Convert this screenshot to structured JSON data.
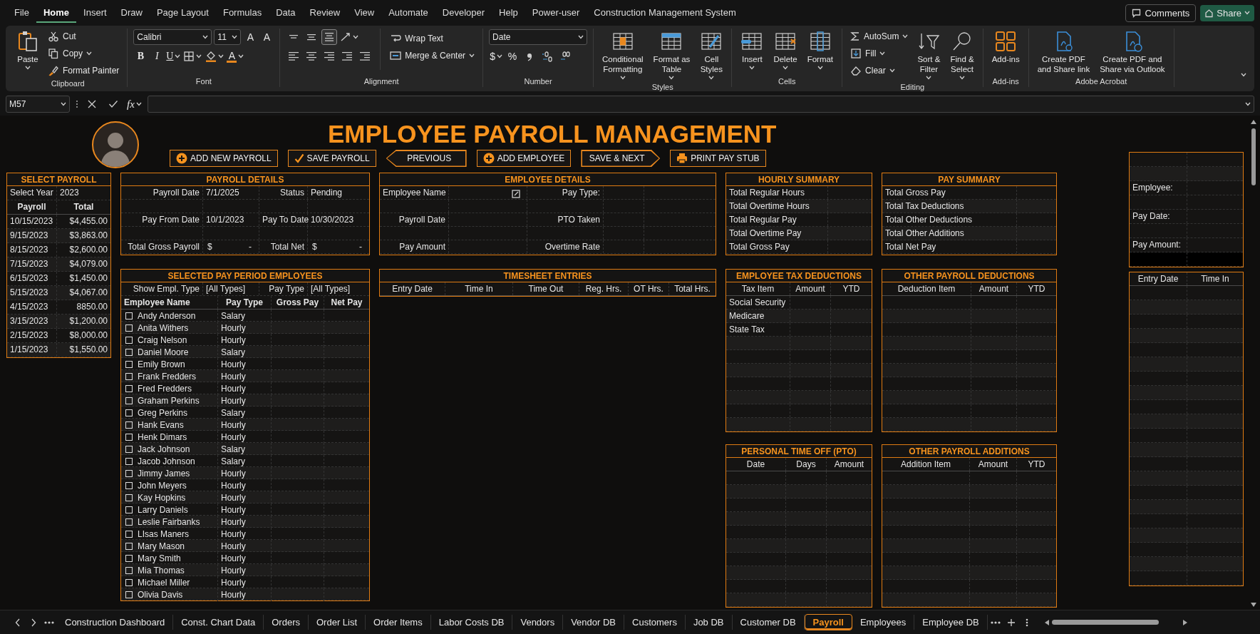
{
  "menu_tabs": [
    {
      "label": "File",
      "selected": false
    },
    {
      "label": "Home",
      "selected": true
    },
    {
      "label": "Insert",
      "selected": false
    },
    {
      "label": "Draw",
      "selected": false
    },
    {
      "label": "Page Layout",
      "selected": false
    },
    {
      "label": "Formulas",
      "selected": false
    },
    {
      "label": "Data",
      "selected": false
    },
    {
      "label": "Review",
      "selected": false
    },
    {
      "label": "View",
      "selected": false
    },
    {
      "label": "Automate",
      "selected": false
    },
    {
      "label": "Developer",
      "selected": false
    },
    {
      "label": "Help",
      "selected": false
    },
    {
      "label": "Power-user",
      "selected": false
    },
    {
      "label": "Construction Management System",
      "selected": false
    }
  ],
  "title_actions": [
    "Comments",
    "Share"
  ],
  "ribbon": [
    {
      "kind": "clipboard",
      "label": "Clipboard",
      "items": [
        "Paste",
        "Cut",
        "Copy",
        "Format Painter"
      ]
    },
    {
      "kind": "font",
      "label": "Font",
      "font_name": "Calibri",
      "font_size": "11",
      "glyphs": [
        "A",
        "A",
        "B",
        "I",
        "U",
        "A"
      ]
    },
    {
      "kind": "alignment",
      "label": "Alignment",
      "valign": [
        {
          "selected": false
        },
        {
          "selected": false
        },
        {
          "selected": true
        }
      ],
      "items": [
        "Wrap Text",
        "Merge & Center"
      ]
    },
    {
      "kind": "number",
      "label": "Number",
      "format": "Date",
      "glyphs": [
        "$",
        "%"
      ]
    },
    {
      "kind": "styles",
      "label": "Styles",
      "items": [
        "Conditional\nFormatting",
        "Format as\nTable",
        "Cell\nStyles"
      ]
    },
    {
      "kind": "cells",
      "label": "Cells",
      "items": [
        "Insert",
        "Delete",
        "Format"
      ]
    },
    {
      "kind": "editing",
      "label": "Editing",
      "items": [
        "AutoSum",
        "Fill",
        "Clear",
        "Sort &\nFilter",
        "Find &\nSelect"
      ]
    },
    {
      "kind": "addins",
      "label": "Add-ins",
      "items": [
        "Add-ins"
      ]
    },
    {
      "kind": "acrobat",
      "label": "Adobe Acrobat",
      "items": [
        "Create PDF\nand Share link",
        "Create PDF and\nShare via Outlook"
      ]
    }
  ],
  "formula_bar": {
    "cell": "M57",
    "function_label": "fx"
  },
  "title": "EMPLOYEE PAYROLL MANAGEMENT",
  "action_buttons": [
    {
      "label": "ADD NEW PAYROLL",
      "kind": "add"
    },
    {
      "label": "SAVE PAYROLL",
      "kind": "check"
    },
    {
      "label": "PREVIOUS",
      "kind": "back"
    },
    {
      "label": "ADD EMPLOYEE",
      "kind": "add"
    },
    {
      "label": "SAVE & NEXT",
      "kind": "next"
    },
    {
      "label": "PRINT PAY STUB",
      "kind": "print"
    }
  ],
  "select_payroll": {
    "title": "SELECT PAYROLL",
    "year_label": "Select Year",
    "year": "2023",
    "columns": [
      "Payroll",
      "Total"
    ],
    "rows": [
      [
        "10/15/2023",
        "$4,455.00"
      ],
      [
        "9/15/2023",
        "$3,863.00"
      ],
      [
        "8/15/2023",
        "$2,600.00"
      ],
      [
        "7/15/2023",
        "$4,079.00"
      ],
      [
        "6/15/2023",
        "$1,450.00"
      ],
      [
        "5/15/2023",
        "$4,067.00"
      ],
      [
        "4/15/2023",
        "8850.00"
      ],
      [
        "3/15/2023",
        "$1,200.00"
      ],
      [
        "2/15/2023",
        "$8,000.00"
      ],
      [
        "1/15/2023",
        "$1,550.00"
      ]
    ]
  },
  "payroll_details": {
    "title": "PAYROLL DETAILS",
    "rows": [
      [
        {
          "label": "Payroll Date",
          "value": "7/1/2025"
        },
        {
          "label": "Status",
          "value": "Pending"
        }
      ],
      [
        {
          "label": "Pay From Date",
          "value": "10/1/2023"
        },
        {
          "label": "Pay To Date",
          "value": "10/30/2023"
        }
      ],
      [
        {
          "label": "Total Gross Payroll",
          "currency": "$",
          "value": "-"
        },
        {
          "label": "Total Net",
          "currency": "$",
          "value": "-"
        }
      ]
    ]
  },
  "employee_details": {
    "title": "EMPLOYEE DETAILS",
    "rows": [
      [
        "Employee Name",
        "Pay Type:"
      ],
      [
        "Payroll Date",
        "PTO Taken"
      ],
      [
        "Pay Amount",
        "Overtime Rate"
      ]
    ]
  },
  "hourly_summary": {
    "title": "HOURLY SUMMARY",
    "rows": [
      "Total Regular Hours",
      "Total Overtime Hours",
      "Total Regular Pay",
      "Total Overtime Pay",
      "Total Gross Pay"
    ]
  },
  "pay_summary": {
    "title": "PAY SUMMARY",
    "rows": [
      "Total Gross Pay",
      "Total Tax Deductions",
      "Total Other Deductions",
      "Total Other Additions",
      "Total Net Pay"
    ]
  },
  "selected_employees": {
    "title": "SELECTED PAY PERIOD EMPLOYEES",
    "filters": [
      {
        "label": "Show Empl. Type",
        "value": "[All Types]"
      },
      {
        "label": "Pay Type",
        "value": "[All Types]"
      }
    ],
    "columns": [
      "Employee Name",
      "Pay Type",
      "Gross Pay",
      "Net Pay"
    ],
    "rows": [
      {
        "name": "Andy Anderson",
        "pay_type": "Salary",
        "checked": false
      },
      {
        "name": "Anita Withers",
        "pay_type": "Hourly",
        "checked": false
      },
      {
        "name": "Craig Nelson",
        "pay_type": "Hourly",
        "checked": false
      },
      {
        "name": "Daniel Moore",
        "pay_type": "Salary",
        "checked": false
      },
      {
        "name": "Emily Brown",
        "pay_type": "Hourly",
        "checked": false
      },
      {
        "name": "Frank Fredders",
        "pay_type": "Hourly",
        "checked": false
      },
      {
        "name": "Fred Fredders",
        "pay_type": "Hourly",
        "checked": false
      },
      {
        "name": "Graham Perkins",
        "pay_type": "Hourly",
        "checked": false
      },
      {
        "name": "Greg Perkins",
        "pay_type": "Salary",
        "checked": false
      },
      {
        "name": "Hank Evans",
        "pay_type": "Hourly",
        "checked": false
      },
      {
        "name": "Henk Dimars",
        "pay_type": "Hourly",
        "checked": false
      },
      {
        "name": "Jack Johnson",
        "pay_type": "Salary",
        "checked": false
      },
      {
        "name": "Jacob Johnson",
        "pay_type": "Salary",
        "checked": false
      },
      {
        "name": "Jimmy James",
        "pay_type": "Hourly",
        "checked": false
      },
      {
        "name": "John Meyers",
        "pay_type": "Hourly",
        "checked": false
      },
      {
        "name": "Kay Hopkins",
        "pay_type": "Hourly",
        "checked": false
      },
      {
        "name": "Larry Daniels",
        "pay_type": "Hourly",
        "checked": false
      },
      {
        "name": "Leslie Fairbanks",
        "pay_type": "Hourly",
        "checked": false
      },
      {
        "name": "LIsas Maners",
        "pay_type": "Hourly",
        "checked": false
      },
      {
        "name": "Mary Mason",
        "pay_type": "Hourly",
        "checked": false
      },
      {
        "name": "Mary Smith",
        "pay_type": "Hourly",
        "checked": false
      },
      {
        "name": "Mia Thomas",
        "pay_type": "Hourly",
        "checked": false
      },
      {
        "name": "Michael Miller",
        "pay_type": "Hourly",
        "checked": false
      },
      {
        "name": "Olivia Davis",
        "pay_type": "Hourly",
        "checked": false
      }
    ]
  },
  "timesheet": {
    "title": "TIMESHEET ENTRIES",
    "columns": [
      "Entry Date",
      "Time In",
      "Time Out",
      "Reg. Hrs.",
      "OT Hrs.",
      "Total Hrs."
    ]
  },
  "tax_deductions": {
    "title": "EMPLOYEE TAX DEDUCTIONS",
    "columns": [
      "Tax Item",
      "Amount",
      "YTD"
    ],
    "rows": [
      "Social Security",
      "Medicare",
      "State Tax"
    ]
  },
  "other_deductions": {
    "title": "OTHER PAYROLL DEDUCTIONS",
    "columns": [
      "Deduction Item",
      "Amount",
      "YTD"
    ]
  },
  "pto": {
    "title": "PERSONAL TIME OFF (PTO)",
    "columns": [
      "Date",
      "Days",
      "Amount"
    ]
  },
  "other_additions": {
    "title": "OTHER PAYROLL ADDITIONS",
    "columns": [
      "Addition Item",
      "Amount",
      "YTD"
    ]
  },
  "pay_stub": {
    "labels": [
      "Employee:",
      "Pay Date:",
      "Pay Amount:"
    ],
    "columns": [
      "Entry Date",
      "Time In"
    ]
  },
  "sheet_tabs": [
    {
      "label": "Construction Dashboard",
      "selected": false
    },
    {
      "label": "Const. Chart Data",
      "selected": false
    },
    {
      "label": "Orders",
      "selected": false
    },
    {
      "label": "Order List",
      "selected": false
    },
    {
      "label": "Order Items",
      "selected": false
    },
    {
      "label": "Labor Costs DB",
      "selected": false
    },
    {
      "label": "Vendors",
      "selected": false
    },
    {
      "label": "Vendor DB",
      "selected": false
    },
    {
      "label": "Customers",
      "selected": false
    },
    {
      "label": "Job DB",
      "selected": false
    },
    {
      "label": "Customer DB",
      "selected": false
    },
    {
      "label": "Payroll",
      "selected": true
    },
    {
      "label": "Employees",
      "selected": false
    },
    {
      "label": "Employee DB",
      "selected": false
    }
  ]
}
